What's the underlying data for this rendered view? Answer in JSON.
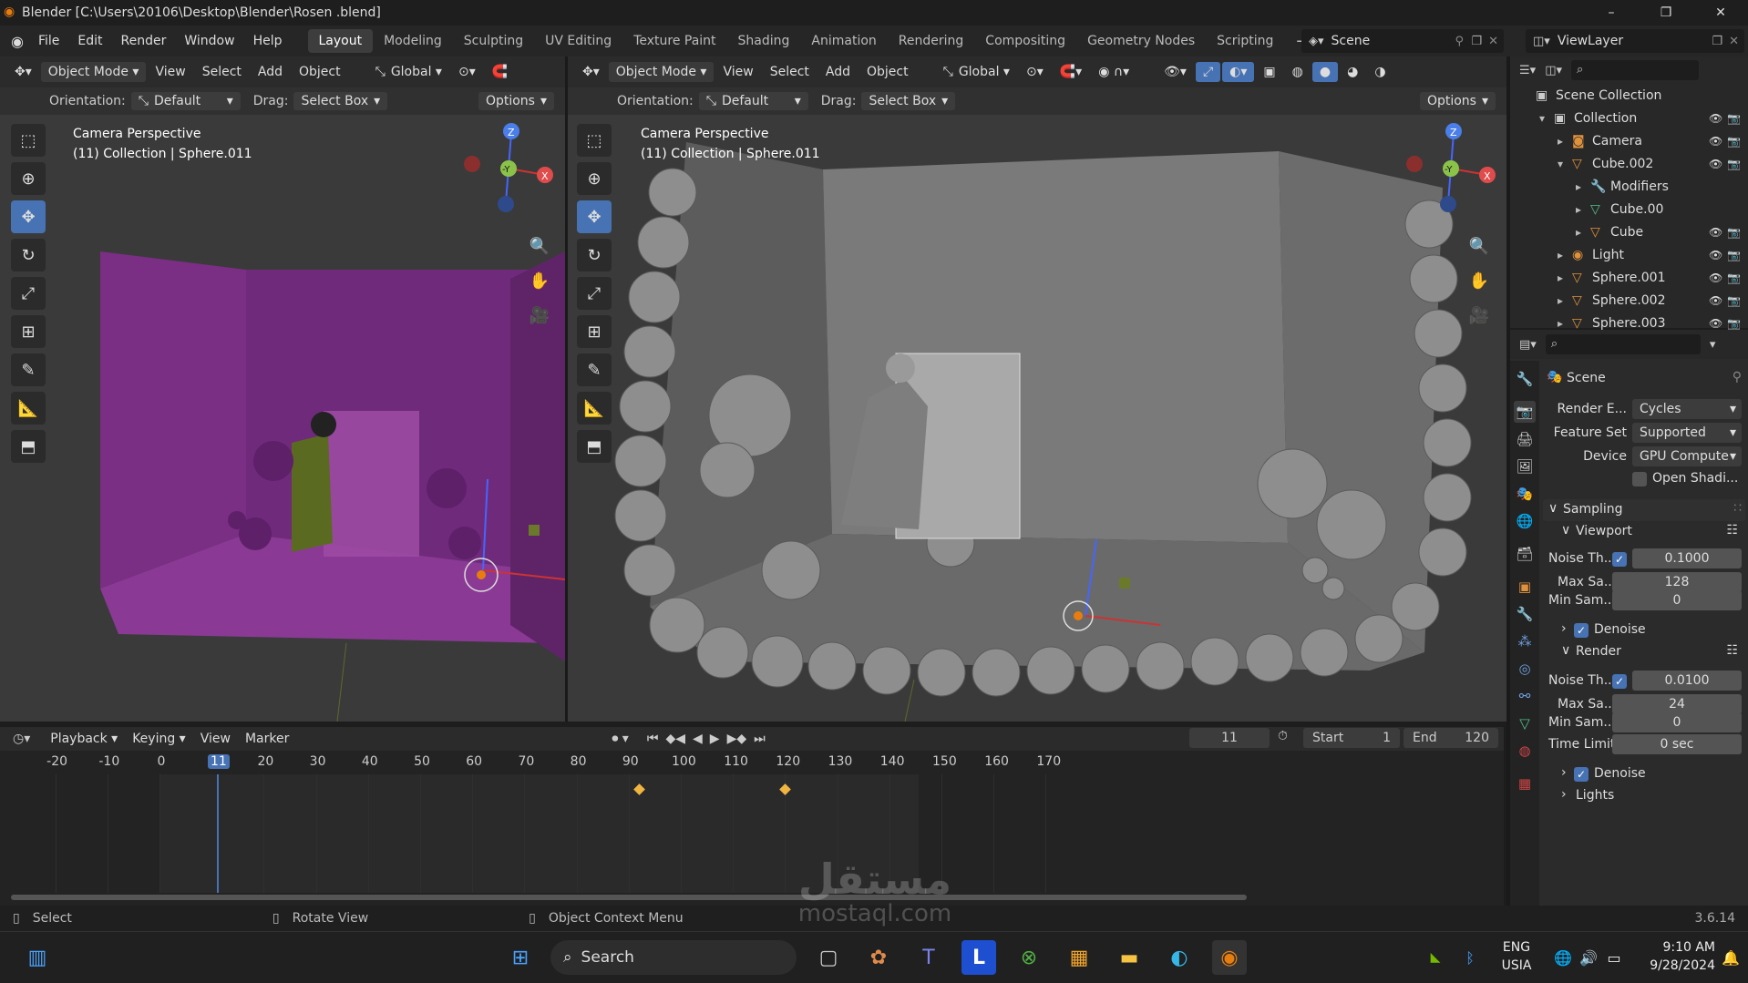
{
  "window": {
    "title": "Blender [C:\\Users\\20106\\Desktop\\Blender\\Rosen .blend]",
    "minimize": "–",
    "maximize": "❐",
    "close": "✕"
  },
  "menu": {
    "items": [
      "File",
      "Edit",
      "Render",
      "Window",
      "Help"
    ]
  },
  "workspaces": [
    "Layout",
    "Modeling",
    "Sculpting",
    "UV Editing",
    "Texture Paint",
    "Shading",
    "Animation",
    "Rendering",
    "Compositing",
    "Geometry Nodes",
    "Scripting"
  ],
  "add_workspace": "+",
  "scene": {
    "label": "Scene"
  },
  "viewlayer": {
    "label": "ViewLayer"
  },
  "left_view": {
    "mode": "Object Mode",
    "menu": [
      "View",
      "Select",
      "Add",
      "Object"
    ],
    "transform": "Global",
    "orientation_label": "Orientation:",
    "orientation": "Default",
    "drag_label": "Drag:",
    "drag": "Select Box",
    "options": "Options",
    "info1": "Camera Perspective",
    "info2": "(11) Collection | Sphere.011"
  },
  "right_view": {
    "mode": "Object Mode",
    "menu": [
      "View",
      "Select",
      "Add",
      "Object"
    ],
    "transform": "Global",
    "orientation_label": "Orientation:",
    "orientation": "Default",
    "drag_label": "Drag:",
    "drag": "Select Box",
    "options": "Options",
    "info1": "Camera Perspective",
    "info2": "(11) Collection | Sphere.011"
  },
  "gizmo": {
    "z": "Z",
    "y": "-Y",
    "x": "X"
  },
  "timeline": {
    "menu": [
      "Playback",
      "Keying",
      "View",
      "Marker"
    ],
    "current": "11",
    "start_label": "Start",
    "start": "1",
    "end_label": "End",
    "end": "120",
    "ticks": [
      "-20",
      "-10",
      "0",
      "11",
      "20",
      "30",
      "40",
      "50",
      "60",
      "70",
      "80",
      "90",
      "100",
      "110",
      "120",
      "130",
      "140",
      "150",
      "160",
      "170"
    ],
    "keyframes": [
      92,
      120
    ]
  },
  "status": {
    "select": "Select",
    "rotate": "Rotate View",
    "context": "Object Context Menu",
    "version": "3.6.14"
  },
  "outliner": {
    "rows": [
      {
        "label": "Scene Collection",
        "indent": 0,
        "arrow": "",
        "icon": "▣",
        "color": "#ccc",
        "vis": false
      },
      {
        "label": "Collection",
        "indent": 1,
        "arrow": "▾",
        "icon": "▣",
        "color": "#ccc",
        "vis": true
      },
      {
        "label": "Camera",
        "indent": 2,
        "arrow": "▸",
        "icon": "◙",
        "color": "#e0913b",
        "vis": true
      },
      {
        "label": "Cube.002",
        "indent": 2,
        "arrow": "▾",
        "icon": "▽",
        "color": "#e0913b",
        "vis": true
      },
      {
        "label": "Modifiers",
        "indent": 3,
        "arrow": "▸",
        "icon": "🔧",
        "color": "#6f9fe0",
        "vis": false
      },
      {
        "label": "Cube.00",
        "indent": 3,
        "arrow": "▸",
        "icon": "▽",
        "color": "#4fc18b",
        "vis": false
      },
      {
        "label": "Cube",
        "indent": 3,
        "arrow": "▸",
        "icon": "▽",
        "color": "#e0913b",
        "vis": true
      },
      {
        "label": "Light",
        "indent": 2,
        "arrow": "▸",
        "icon": "◉",
        "color": "#e0913b",
        "vis": true
      },
      {
        "label": "Sphere.001",
        "indent": 2,
        "arrow": "▸",
        "icon": "▽",
        "color": "#e0913b",
        "vis": true
      },
      {
        "label": "Sphere.002",
        "indent": 2,
        "arrow": "▸",
        "icon": "▽",
        "color": "#e0913b",
        "vis": true
      },
      {
        "label": "Sphere.003",
        "indent": 2,
        "arrow": "▸",
        "icon": "▽",
        "color": "#e0913b",
        "vis": true
      }
    ]
  },
  "props": {
    "scene": "Scene",
    "render_engine_label": "Render E...",
    "render_engine": "Cycles",
    "feature_set_label": "Feature Set",
    "feature_set": "Supported",
    "device_label": "Device",
    "device": "GPU Compute",
    "open_shading": "Open Shadi...",
    "sampling": "Sampling",
    "viewport": "Viewport",
    "vp_noise_label": "Noise Th...",
    "vp_noise": "0.1000",
    "vp_max_label": "Max Sa...",
    "vp_max": "128",
    "vp_min_label": "Min Sam...",
    "vp_min": "0",
    "denoise": "Denoise",
    "render": "Render",
    "r_noise_label": "Noise Th...",
    "r_noise": "0.0100",
    "r_max_label": "Max Sa...",
    "r_max": "24",
    "r_min_label": "Min Sam...",
    "r_min": "0",
    "time_label": "Time Limit",
    "time": "0 sec",
    "denoise2": "Denoise",
    "lights": "Lights"
  },
  "taskbar": {
    "search": "Search",
    "lang1": "ENG",
    "lang2": "USIA",
    "time": "9:10 AM",
    "date": "9/28/2024"
  },
  "watermark": {
    "text": "مستقل",
    "url": "mostaql.com"
  }
}
